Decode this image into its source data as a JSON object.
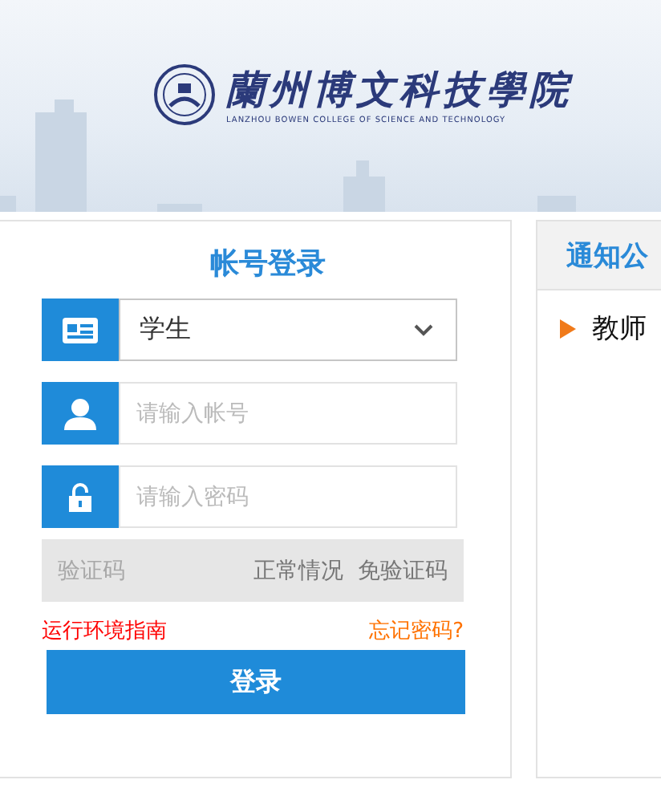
{
  "banner": {
    "school_name": "蘭州博文科技學院",
    "school_name_en": "LANZHOU BOWEN COLLEGE OF SCIENCE AND TECHNOLOGY"
  },
  "login": {
    "title": "帐号登录",
    "role_select": {
      "value": "学生"
    },
    "fields": [
      {
        "kind": "user",
        "placeholder": "请输入帐号"
      },
      {
        "kind": "lock",
        "placeholder": "请输入密码"
      }
    ],
    "captcha": {
      "placeholder": "验证码",
      "note": "正常情况  免验证码"
    },
    "env_guide_link": "运行环境指南",
    "forgot_link": "忘记密码?",
    "submit": "登录"
  },
  "notices": {
    "title": "通知公",
    "items": [
      "教师"
    ]
  }
}
